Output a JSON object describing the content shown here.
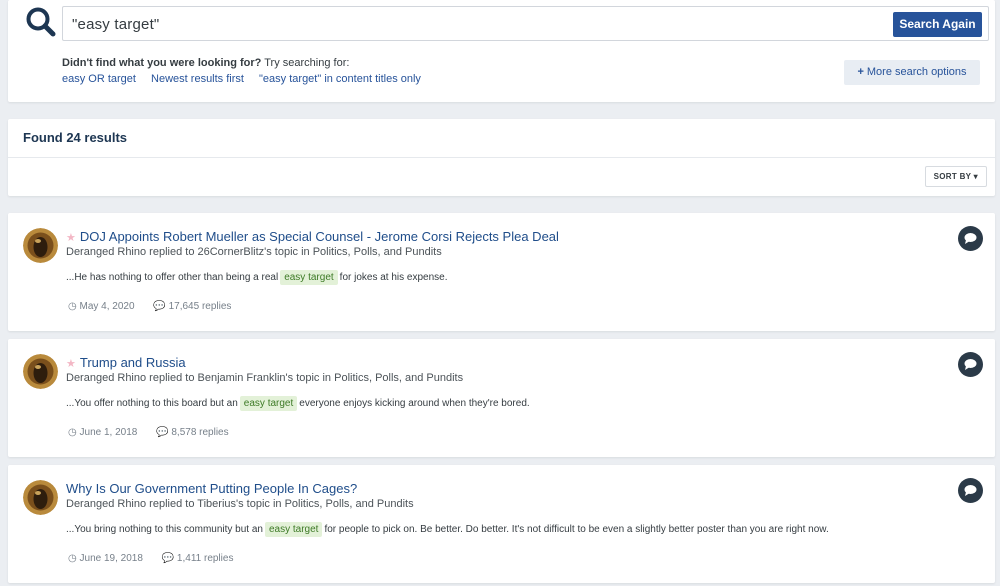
{
  "search": {
    "query": "\"easy target\"",
    "button": "Search Again"
  },
  "suggestions": {
    "prompt_bold": "Didn't find what you were looking for?",
    "prompt_rest": " Try searching for:",
    "links": [
      "easy OR target",
      "Newest results first",
      "\"easy target\" in content titles only"
    ],
    "more_options": "More search options"
  },
  "results_header": {
    "title": "Found 24 results",
    "sort_label": "SORT BY"
  },
  "results": [
    {
      "title": "DOJ Appoints Robert Mueller as Special Counsel - Jerome Corsi Rejects Plea Deal",
      "has_star": true,
      "author": "Deranged Rhino",
      "replied_text": " replied to ",
      "topic_owner": "26CornerBlitz's",
      "topic_text": " topic in ",
      "forum": "Politics, Polls, and Pundits",
      "snippet_before": "...He has nothing to offer other than being a real",
      "highlight": "easy target",
      "snippet_after": "for jokes at his expense.",
      "date": "May 4, 2020",
      "replies": "17,645 replies"
    },
    {
      "title": "Trump and Russia",
      "has_star": true,
      "author": "Deranged Rhino",
      "replied_text": " replied to ",
      "topic_owner": "Benjamin Franklin's",
      "topic_text": " topic in ",
      "forum": "Politics, Polls, and Pundits",
      "snippet_before": "...You offer nothing to this board but an",
      "highlight": "easy target",
      "snippet_after": "everyone enjoys kicking around when they're bored.",
      "date": "June 1, 2018",
      "replies": "8,578 replies"
    },
    {
      "title": "Why Is Our Government Putting People In Cages?",
      "has_star": false,
      "author": "Deranged Rhino",
      "replied_text": " replied to ",
      "topic_owner": "Tiberius's",
      "topic_text": " topic in ",
      "forum": "Politics, Polls, and Pundits",
      "snippet_before": "...You bring nothing to this community but an",
      "highlight": "easy target",
      "snippet_after": "for people to pick on. Be better. Do better. It's not difficult to be even a slightly better poster than you are right now.",
      "date": "June 19, 2018",
      "replies": "1,411 replies"
    }
  ],
  "colors": {
    "accent": "#27539a",
    "link": "#1f4d8a",
    "highlight_bg": "#e3f1d8",
    "highlight_text": "#3d7a26"
  }
}
